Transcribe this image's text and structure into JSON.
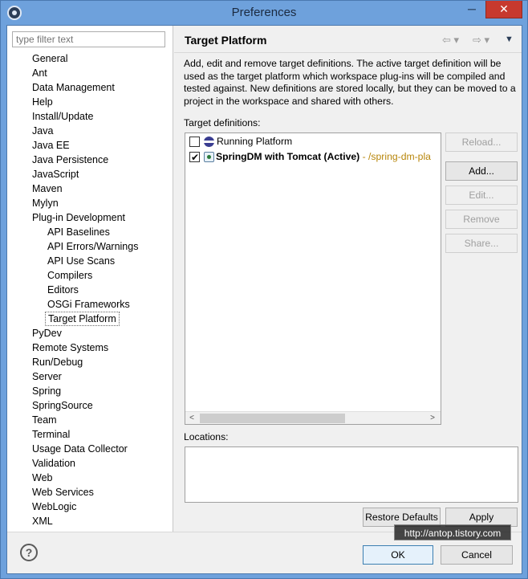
{
  "window": {
    "title": "Preferences",
    "minimize": "─",
    "close": "✕"
  },
  "filter": {
    "placeholder": "type filter text"
  },
  "tree": [
    {
      "label": "General"
    },
    {
      "label": "Ant"
    },
    {
      "label": "Data Management"
    },
    {
      "label": "Help"
    },
    {
      "label": "Install/Update"
    },
    {
      "label": "Java"
    },
    {
      "label": "Java EE"
    },
    {
      "label": "Java Persistence"
    },
    {
      "label": "JavaScript"
    },
    {
      "label": "Maven"
    },
    {
      "label": "Mylyn"
    },
    {
      "label": "Plug-in Development"
    },
    {
      "label": "API Baselines"
    },
    {
      "label": "API Errors/Warnings"
    },
    {
      "label": "API Use Scans"
    },
    {
      "label": "Compilers"
    },
    {
      "label": "Editors"
    },
    {
      "label": "OSGi Frameworks"
    },
    {
      "label": "Target Platform"
    },
    {
      "label": "PyDev"
    },
    {
      "label": "Remote Systems"
    },
    {
      "label": "Run/Debug"
    },
    {
      "label": "Server"
    },
    {
      "label": "Spring"
    },
    {
      "label": "SpringSource"
    },
    {
      "label": "Team"
    },
    {
      "label": "Terminal"
    },
    {
      "label": "Usage Data Collector"
    },
    {
      "label": "Validation"
    },
    {
      "label": "Web"
    },
    {
      "label": "Web Services"
    },
    {
      "label": "WebLogic"
    },
    {
      "label": "XML"
    }
  ],
  "page": {
    "title": "Target Platform",
    "nav_back": "⇦ ▾",
    "nav_forward": "⇨ ▾",
    "menu": "▼",
    "description": "Add, edit and remove target definitions.  The active target definition will be used as the target platform which workspace plug-ins will be compiled and tested against.  New definitions are stored locally, but they can be moved to a project in the workspace and shared with others.",
    "definitions_label": "Target definitions:",
    "definitions": [
      {
        "name": "Running Platform",
        "path": "",
        "checked": false
      },
      {
        "name": "SpringDM with Tomcat (Active)",
        "path": " - /spring-dm-pla",
        "checked": true
      }
    ],
    "scroll_left": "<",
    "scroll_right": ">",
    "buttons": {
      "reload": "Reload...",
      "add": "Add...",
      "edit": "Edit...",
      "remove": "Remove",
      "share": "Share..."
    },
    "locations_label": "Locations:",
    "restore_defaults": "Restore Defaults",
    "apply": "Apply"
  },
  "footer": {
    "help": "?",
    "ok": "OK",
    "cancel": "Cancel"
  },
  "watermark": "http://antop.tistory.com"
}
